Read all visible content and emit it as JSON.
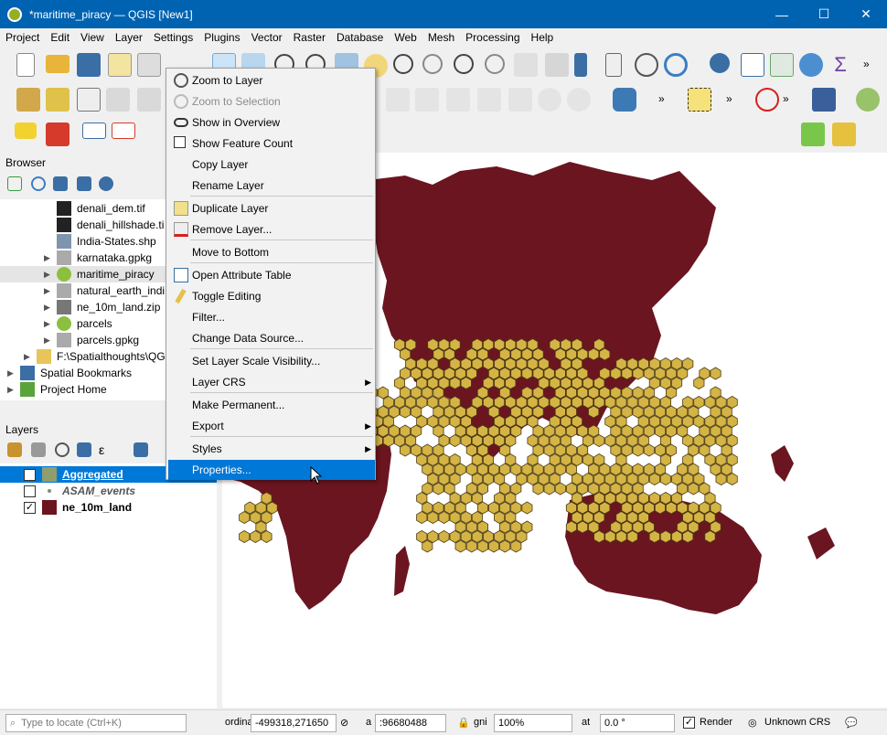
{
  "window": {
    "title": "*maritime_piracy — QGIS [New1]",
    "minimize": "—",
    "maximize": "☐",
    "close": "✕"
  },
  "menubar": [
    "Project",
    "Edit",
    "View",
    "Layer",
    "Settings",
    "Plugins",
    "Vector",
    "Raster",
    "Database",
    "Web",
    "Mesh",
    "Processing",
    "Help"
  ],
  "browser": {
    "title": "Browser",
    "items": [
      {
        "label": "denali_dem.tif",
        "icon": "raster-icon"
      },
      {
        "label": "denali_hillshade.ti",
        "icon": "raster-icon"
      },
      {
        "label": "India-States.shp",
        "icon": "vector-polygon-icon"
      },
      {
        "label": "karnataka.gpkg",
        "icon": "database-icon"
      },
      {
        "label": "maritime_piracy",
        "icon": "qgis-project-icon"
      },
      {
        "label": "natural_earth_indi",
        "icon": "database-icon"
      },
      {
        "label": "ne_10m_land.zip",
        "icon": "zip-icon"
      },
      {
        "label": "parcels",
        "icon": "qgis-project-icon"
      },
      {
        "label": "parcels.gpkg",
        "icon": "database-icon"
      },
      {
        "label": "F:\\Spatialthoughts\\QG",
        "icon": "folder-icon"
      },
      {
        "label": "Spatial Bookmarks",
        "icon": "bookmark-icon"
      },
      {
        "label": "Project Home",
        "icon": "home-icon"
      }
    ]
  },
  "layers": {
    "title": "Layers",
    "items": [
      {
        "label": "Aggregated",
        "checked": true,
        "color": "#8f9e6f"
      },
      {
        "label": "ASAM_events",
        "checked": false,
        "color": ""
      },
      {
        "label": "ne_10m_land",
        "checked": true,
        "color": "#6b1520"
      }
    ]
  },
  "context_menu": {
    "items": [
      {
        "label": "Zoom to Layer",
        "icon": "zoom-layer-icon"
      },
      {
        "label": "Zoom to Selection",
        "icon": "zoom-selection-icon",
        "disabled": true
      },
      {
        "label": "Show in Overview",
        "icon": "overview-icon"
      },
      {
        "label": "Show Feature Count",
        "icon": "checkbox-icon"
      },
      {
        "label": "Copy Layer",
        "icon": ""
      },
      {
        "label": "Rename Layer",
        "icon": ""
      },
      {
        "label": "Duplicate Layer",
        "icon": "duplicate-icon"
      },
      {
        "label": "Remove Layer...",
        "icon": "remove-layer-icon"
      },
      {
        "label": "Move to Bottom",
        "icon": ""
      },
      {
        "label": "Open Attribute Table",
        "icon": "table-icon"
      },
      {
        "label": "Toggle Editing",
        "icon": "pencil-icon"
      },
      {
        "label": "Filter...",
        "icon": ""
      },
      {
        "label": "Change Data Source...",
        "icon": ""
      },
      {
        "label": "Set Layer Scale Visibility...",
        "icon": ""
      },
      {
        "label": "Layer CRS",
        "icon": "",
        "submenu": true
      },
      {
        "label": "Make Permanent...",
        "icon": ""
      },
      {
        "label": "Export",
        "icon": "",
        "submenu": true
      },
      {
        "label": "Styles",
        "icon": "",
        "submenu": true
      },
      {
        "label": "Properties...",
        "icon": "",
        "selected": true
      }
    ]
  },
  "statusbar": {
    "locator_placeholder": "Type to locate (Ctrl+K)",
    "coordinate_label": "ordina",
    "coordinate": "-499318,271650",
    "scale_label": "a",
    "scale": ":96680488",
    "magnifier_label": "gni",
    "magnifier": "100%",
    "rotation_label": "at",
    "rotation": "0.0 °",
    "render_label": "Render",
    "crs": "Unknown CRS"
  },
  "colors": {
    "land": "#6b1520",
    "hex": "#d4b445",
    "titlebar": "#0063b1",
    "selection": "#0078d7"
  }
}
